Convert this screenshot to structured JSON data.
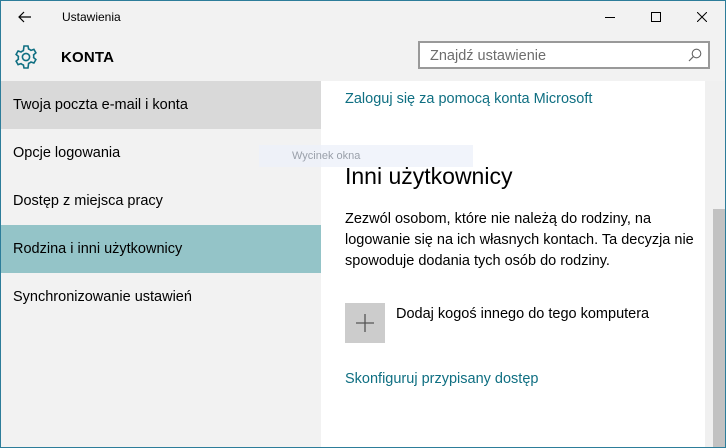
{
  "window": {
    "title": "Ustawienia"
  },
  "header": {
    "section_title": "KONTA",
    "search_placeholder": "Znajdź ustawienie"
  },
  "sidebar": {
    "items": [
      {
        "label": "Twoja poczta e-mail i konta",
        "state": "hover"
      },
      {
        "label": "Opcje logowania",
        "state": "normal"
      },
      {
        "label": "Dostęp z miejsca pracy",
        "state": "normal"
      },
      {
        "label": "Rodzina i inni użytkownicy",
        "state": "selected"
      },
      {
        "label": "Synchronizowanie ustawień",
        "state": "normal"
      }
    ]
  },
  "tooltip": {
    "text": "Wycinek okna"
  },
  "content": {
    "ms_link": "Zaloguj się za pomocą konta Microsoft",
    "heading": "Inni użytkownicy",
    "description": "Zezwól osobom, które nie należą do rodziny, na logowanie się na ich własnych kontach. Ta decyzja nie spowoduje dodania tych osób do rodziny.",
    "add_label": "Dodaj kogoś innego do tego komputera",
    "assigned_link": "Skonfiguruj przypisany dostęp"
  },
  "icons": {
    "back": "arrow-left-icon",
    "minimize": "minimize-icon",
    "maximize": "maximize-icon",
    "close": "close-icon",
    "settings": "gear-icon",
    "search": "search-icon",
    "add": "plus-icon"
  },
  "colors": {
    "accent": "#0f6f82",
    "selected_bg": "#94c4c8",
    "hover_bg": "#d9d9d9",
    "chrome_bg": "#f2f2f2"
  }
}
